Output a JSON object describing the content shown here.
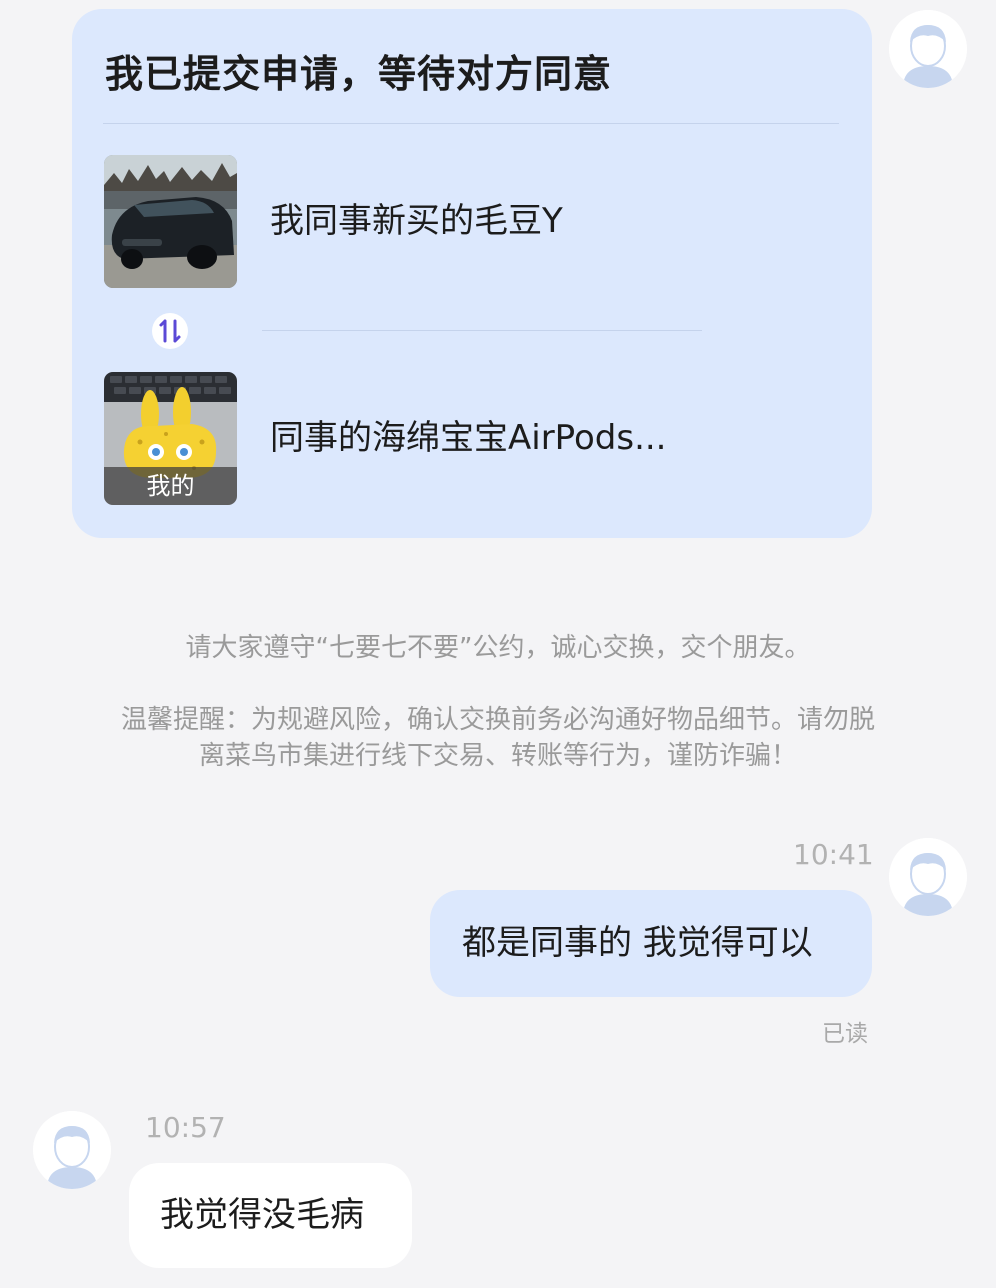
{
  "exchange_card": {
    "title": "我已提交申请，等待对方同意",
    "their_item": {
      "title": "我同事新买的毛豆Y",
      "thumbnail_icon": "car-photo"
    },
    "swap_icon": "swap-arrows-icon",
    "my_item": {
      "title": "同事的海绵宝宝AirPods...",
      "thumbnail_icon": "spongebob-airpods-photo",
      "badge": "我的"
    }
  },
  "notices": {
    "pledge": "请大家遵守“七要七不要”公约，诚心交换，交个朋友。",
    "reminder_line1": "温馨提醒：为规避风险，确认交换前务必沟通好物品细节。请勿脱",
    "reminder_line2": "离菜鸟市集进行线下交易、转账等行为，谨防诈骗！"
  },
  "messages": [
    {
      "direction": "outgoing",
      "time": "10:41",
      "text": "都是同事的 我觉得可以",
      "status": "已读"
    },
    {
      "direction": "incoming",
      "time": "10:57",
      "text": "我觉得没毛病"
    }
  ],
  "colors": {
    "page_background": "#f4f4f6",
    "card_background": "#dce8fd",
    "outgoing_bubble": "#dce8fd",
    "incoming_bubble": "#ffffff",
    "swap_icon_color": "#5b49d6",
    "muted_text": "#9a9a9a"
  }
}
